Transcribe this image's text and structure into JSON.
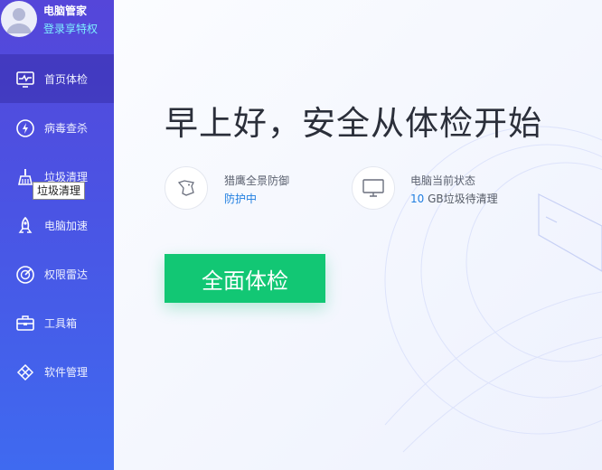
{
  "app": {
    "name": "电脑管家",
    "login_text": "登录享特权"
  },
  "nav": [
    {
      "label": "首页体检",
      "icon": "monitor-pulse-icon",
      "active": true
    },
    {
      "label": "病毒查杀",
      "icon": "lightning-shield-icon"
    },
    {
      "label": "垃圾清理",
      "icon": "broom-icon"
    },
    {
      "label": "电脑加速",
      "icon": "rocket-icon"
    },
    {
      "label": "权限雷达",
      "icon": "radar-icon"
    },
    {
      "label": "工具箱",
      "icon": "toolbox-icon"
    },
    {
      "label": "软件管理",
      "icon": "software-icon"
    }
  ],
  "tooltip": {
    "text": "垃圾清理"
  },
  "main": {
    "greeting": "早上好，安全从体检开始",
    "defense": {
      "title": "猎鹰全景防御",
      "status": "防护中",
      "icon": "eagle-icon"
    },
    "pc_status": {
      "title": "电脑当前状态",
      "amount": "10",
      "unit_text": "GB垃圾待清理",
      "icon": "monitor-icon"
    },
    "scan_button": "全面体检"
  },
  "colors": {
    "sidebar": "#4a54e4",
    "accent": "#12c774",
    "link": "#1f7ee0"
  }
}
